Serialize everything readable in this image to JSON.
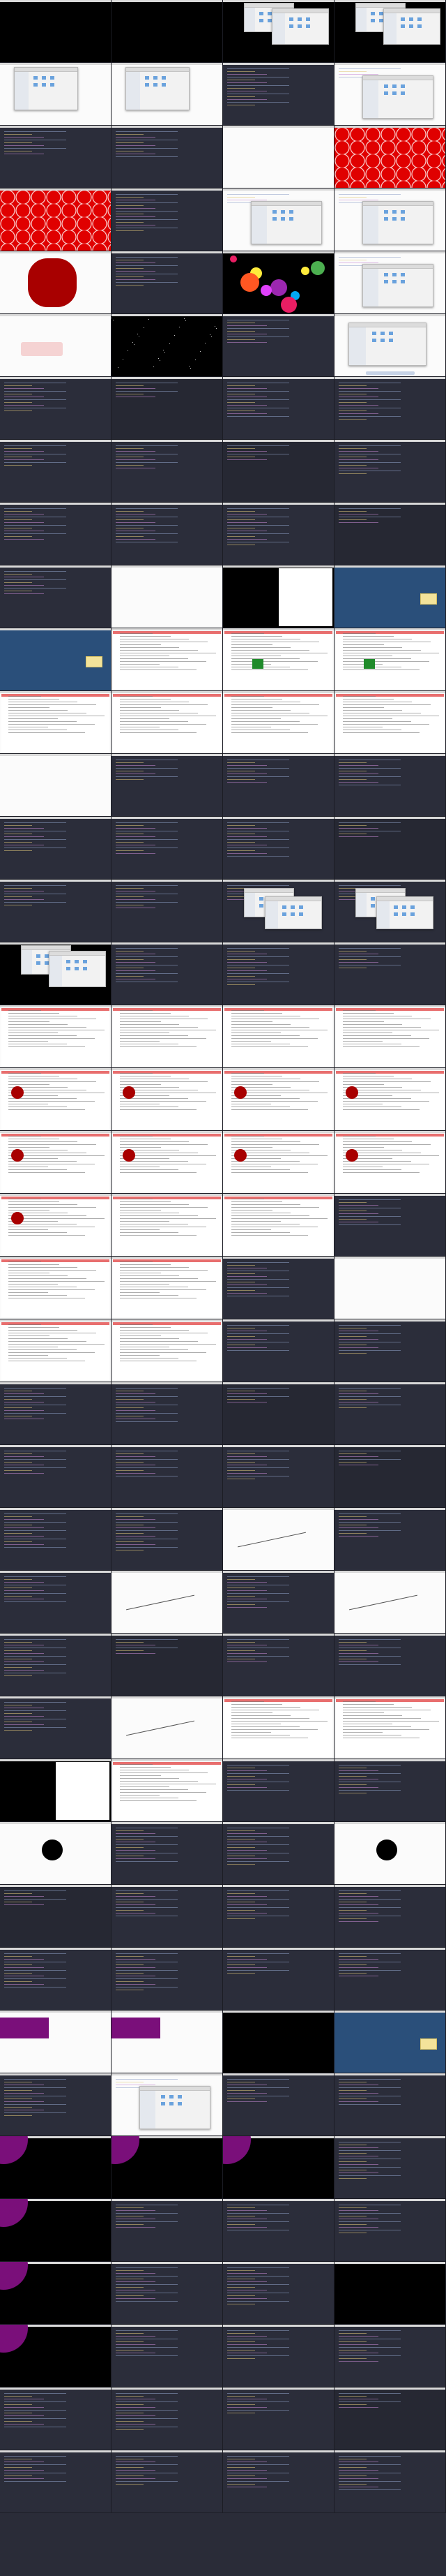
{
  "sheet": {
    "frame_count": 160,
    "columns": 4
  }
}
